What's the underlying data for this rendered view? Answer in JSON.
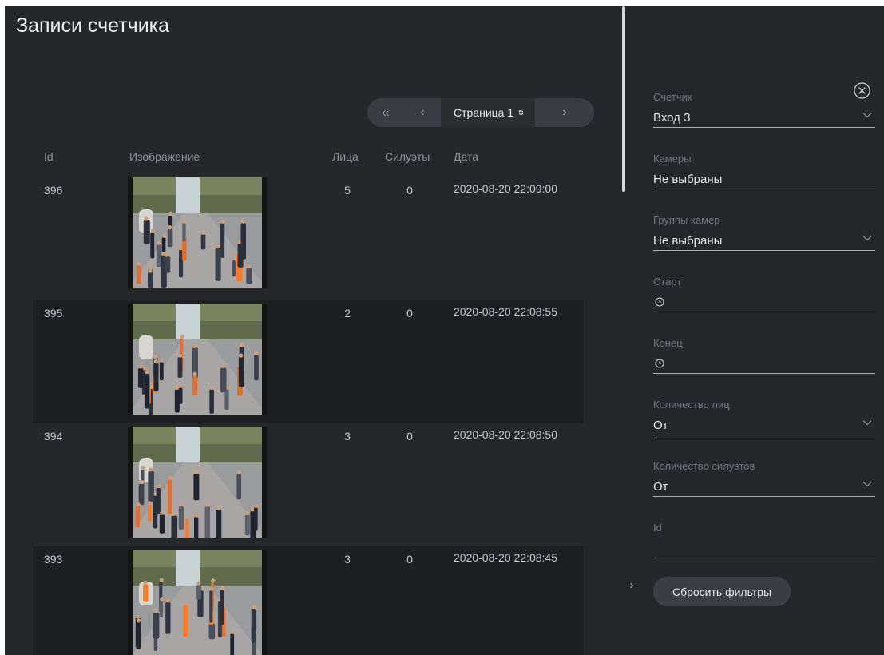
{
  "page": {
    "title": "Записи счетчика"
  },
  "pager": {
    "first": "«",
    "prev": "‹",
    "current": "Страница 1",
    "next": "›"
  },
  "table": {
    "columns": {
      "id": "Id",
      "image": "Изображение",
      "faces": "Лица",
      "silhouettes": "Силуэты",
      "date": "Дата"
    },
    "rows": [
      {
        "id": "396",
        "faces": "5",
        "silhouettes": "0",
        "date": "2020-08-20 22:09:00"
      },
      {
        "id": "395",
        "faces": "2",
        "silhouettes": "0",
        "date": "2020-08-20 22:08:55"
      },
      {
        "id": "394",
        "faces": "3",
        "silhouettes": "0",
        "date": "2020-08-20 22:08:50"
      },
      {
        "id": "393",
        "faces": "3",
        "silhouettes": "0",
        "date": "2020-08-20 22:08:45"
      }
    ]
  },
  "filters": {
    "counter": {
      "label": "Счетчик",
      "value": "Вход 3"
    },
    "cameras": {
      "label": "Камеры",
      "value": "Не выбраны"
    },
    "camera_groups": {
      "label": "Группы камер",
      "value": "Не выбраны"
    },
    "start": {
      "label": "Старт",
      "value": ""
    },
    "end": {
      "label": "Конец",
      "value": ""
    },
    "faces_count": {
      "label": "Количество лиц",
      "value": "От"
    },
    "silhouettes_count": {
      "label": "Количество силуэтов",
      "value": "От"
    },
    "id": {
      "label": "Id",
      "value": ""
    },
    "reset_label": "Сбросить фильтры"
  },
  "icons": {
    "close": "close-circle-icon",
    "refresh": "refresh-icon",
    "chevron": "chevron-down-icon",
    "clock": "clock-icon",
    "collapse": "chevron-right-icon"
  },
  "colors": {
    "background": "#25272a",
    "row_alt": "#1d1f22",
    "pager_bg": "#393c41",
    "button_bg": "#3b3e43"
  }
}
